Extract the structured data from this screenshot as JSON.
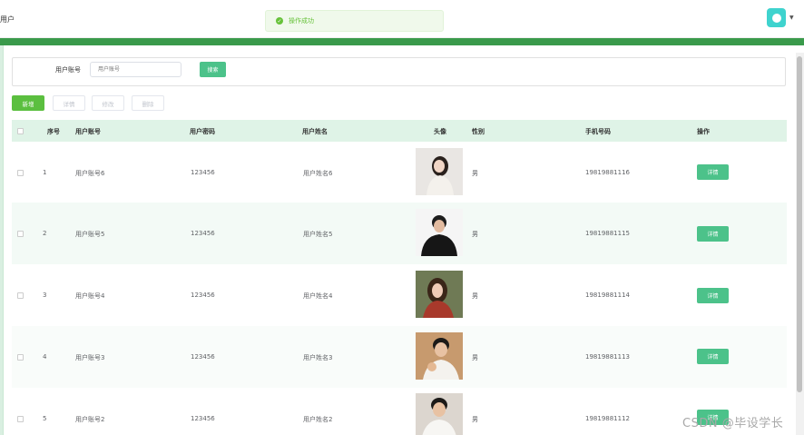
{
  "header": {
    "breadcrumb": "用户",
    "toast": "操作成功",
    "toast_icon": "check-icon"
  },
  "search": {
    "label": "用户账号",
    "placeholder": "用户账号",
    "button": "搜索"
  },
  "actions": {
    "add": "新增",
    "detail": "详情",
    "edit": "修改",
    "delete": "删除"
  },
  "table": {
    "columns": [
      "序号",
      "用户账号",
      "用户密码",
      "用户姓名",
      "头像",
      "性别",
      "手机号码",
      "操作"
    ],
    "rows": [
      {
        "index": "1",
        "account": "用户账号6",
        "password": "123456",
        "name": "用户姓名6",
        "gender": "男",
        "phone": "19819881116",
        "action": "详情"
      },
      {
        "index": "2",
        "account": "用户账号5",
        "password": "123456",
        "name": "用户姓名5",
        "gender": "男",
        "phone": "19819881115",
        "action": "详情"
      },
      {
        "index": "3",
        "account": "用户账号4",
        "password": "123456",
        "name": "用户姓名4",
        "gender": "男",
        "phone": "19819881114",
        "action": "详情"
      },
      {
        "index": "4",
        "account": "用户账号3",
        "password": "123456",
        "name": "用户姓名3",
        "gender": "男",
        "phone": "19819881113",
        "action": "详情"
      },
      {
        "index": "5",
        "account": "用户账号2",
        "password": "123456",
        "name": "用户姓名2",
        "gender": "男",
        "phone": "19819881112",
        "action": "详情"
      }
    ]
  },
  "watermark": "CSDN @毕设学长",
  "colors": {
    "primary": "#4cc28a",
    "header_bar": "#3a9a4b",
    "table_header": "#dff3e7",
    "row_stripe": "#f3faf6",
    "add_button": "#5bbf3f"
  }
}
